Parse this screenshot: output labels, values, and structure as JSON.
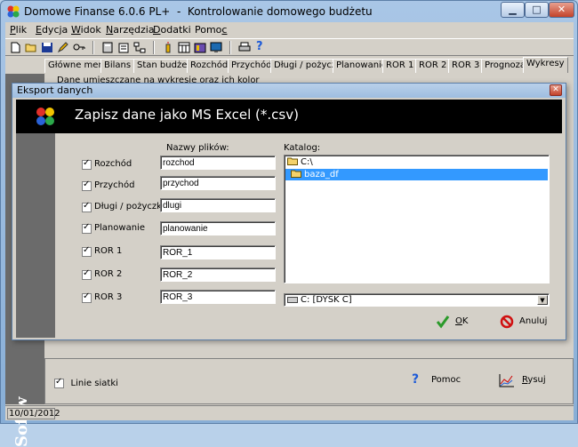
{
  "window": {
    "app_title": "Domowe Finanse 6.0.6 PL+",
    "subtitle": "Kontrolowanie domowego budżetu"
  },
  "menu": [
    {
      "first": "P",
      "rest": "lik"
    },
    {
      "first": "E",
      "rest": "dycja"
    },
    {
      "first": "W",
      "rest": "idok"
    },
    {
      "first": "N",
      "rest": "arzędzia"
    },
    {
      "first": "D",
      "rest": "odatki"
    },
    {
      "first": "Pomo",
      "rest": "c"
    }
  ],
  "tabs": [
    "Główne menu",
    "Bilans",
    "Stan budżetu",
    "Rozchód",
    "Przychód",
    "Długi / pożyczki",
    "Planowanie",
    "ROR 1",
    "ROR 2",
    "ROR 3",
    "Prognoza",
    "Wykresy"
  ],
  "background": {
    "note": "Dane umieszczane na wykresie oraz ich kolor",
    "side_label": "Softw",
    "grid_checkbox_label": "Linie siatki",
    "help_label": "Pomoc",
    "draw_label": "Rysuj",
    "draw_label_first": "R",
    "draw_label_rest": "ysuj"
  },
  "status": {
    "date": "10/01/2012"
  },
  "dialog": {
    "title": "Eksport danych",
    "heading": "Zapisz dane jako MS Excel (*.csv)",
    "files_header": "Nazwy plików:",
    "catalog_header": "Katalog:",
    "rows": [
      {
        "label": "Rozchód",
        "value": "rozchod",
        "checked": true
      },
      {
        "label": "Przychód",
        "value": "przychod",
        "checked": true
      },
      {
        "label": "Długi / pożyczki",
        "value": "dlugi",
        "checked": true
      },
      {
        "label": "Planowanie",
        "value": "planowanie",
        "checked": true
      },
      {
        "label": "ROR 1",
        "value": "ROR_1",
        "checked": true
      },
      {
        "label": "ROR 2",
        "value": "ROR_2",
        "checked": true
      },
      {
        "label": "ROR 3",
        "value": "ROR_3",
        "checked": true
      }
    ],
    "directories": [
      "C:\\",
      "baza_df"
    ],
    "selected_directory": "baza_df",
    "drive": "C: [DYSK C]",
    "ok_first": "O",
    "ok_rest": "K",
    "cancel_label": "Anuluj"
  },
  "colors": {
    "selection": "#3399ff",
    "header_bg": "#000000",
    "panel_dark": "#6b6b6b",
    "face": "#d4d0c8"
  }
}
